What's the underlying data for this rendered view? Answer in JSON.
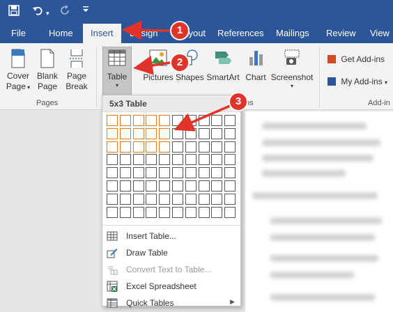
{
  "quick_access": {
    "save_icon": "save-icon",
    "undo_icon": "undo-icon",
    "redo_icon": "redo-icon",
    "customize_icon": "customize-icon"
  },
  "tabs": [
    {
      "label": "File"
    },
    {
      "label": "Home"
    },
    {
      "label": "Insert"
    },
    {
      "label": "Design"
    },
    {
      "label": "Layout"
    },
    {
      "label": "References"
    },
    {
      "label": "Mailings"
    },
    {
      "label": "Review"
    },
    {
      "label": "View"
    }
  ],
  "ribbon": {
    "pages": {
      "group_label": "Pages",
      "cover_page": [
        "Cover",
        "Page"
      ],
      "blank_page": [
        "Blank",
        "Page"
      ],
      "page_break": [
        "Page",
        "Break"
      ]
    },
    "tables": {
      "table_label": "Table"
    },
    "illustrations": {
      "pictures": "Pictures",
      "shapes": "Shapes",
      "smartart": "SmartArt",
      "chart": "Chart",
      "screenshot": "Screenshot",
      "group_label_partial": "ns"
    },
    "addins": {
      "get_addins": "Get Add-ins",
      "my_addins": "My Add-ins",
      "group_label_partial": "Add-in"
    }
  },
  "table_dropdown": {
    "title": "5x3 Table",
    "grid_cols": 10,
    "grid_rows": 8,
    "selected_cols": 5,
    "selected_rows": 3,
    "menu": [
      {
        "label": "Insert Table...",
        "icon": "insert-table-icon",
        "disabled": false
      },
      {
        "label": "Draw Table",
        "icon": "draw-table-icon",
        "disabled": false
      },
      {
        "label": "Convert Text to Table...",
        "icon": "convert-text-icon",
        "disabled": true
      },
      {
        "label": "Excel Spreadsheet",
        "icon": "excel-spreadsheet-icon",
        "disabled": false
      },
      {
        "label": "Quick Tables",
        "icon": "quick-tables-icon",
        "disabled": false
      }
    ]
  },
  "annotations": {
    "step1": "1",
    "step2": "2",
    "step3": "3",
    "arrow_color": "#e0342a"
  },
  "colors": {
    "title_bar": "#2b579a",
    "selection_orange": "#e37b24"
  }
}
